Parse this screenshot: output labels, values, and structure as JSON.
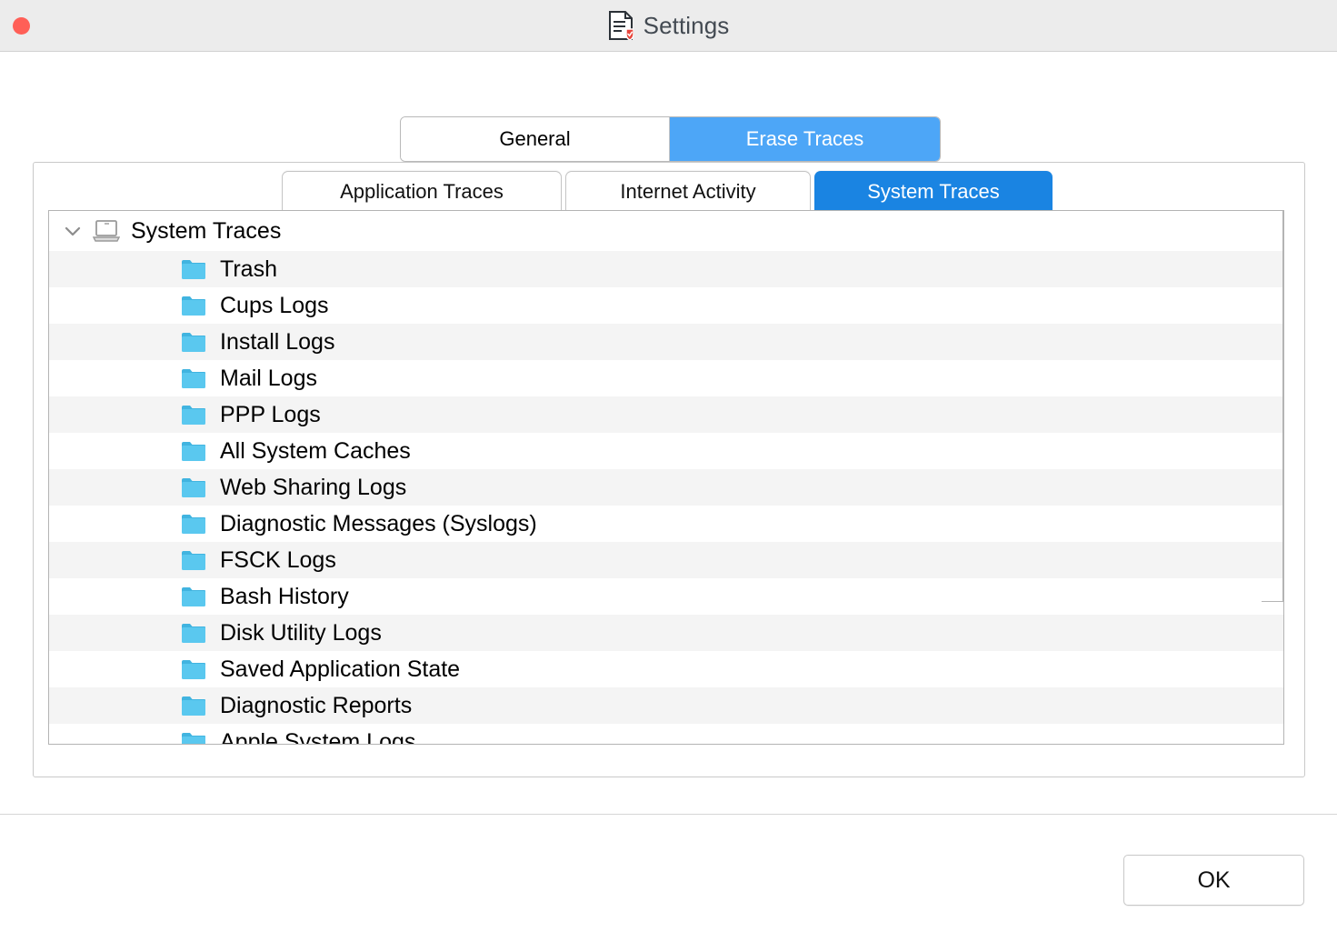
{
  "window": {
    "title": "Settings",
    "title_icon": "document-shield-icon",
    "close_button": "close-window-button",
    "close_color": "#ff5f57",
    "titlebar_color": "#ececec"
  },
  "outer_tabs": {
    "active": "Erase Traces",
    "active_color": "#4da6f7",
    "items": [
      {
        "label": "General",
        "active": false
      },
      {
        "label": "Erase Traces",
        "active": true
      }
    ]
  },
  "inner_tabs": {
    "active": "System Traces",
    "active_color": "#1a84e2",
    "items": [
      {
        "label": "Application Traces",
        "active": false
      },
      {
        "label": "Internet Activity",
        "active": false
      },
      {
        "label": "System Traces",
        "active": true
      }
    ]
  },
  "tree": {
    "root": {
      "label": "System Traces",
      "icon": "laptop-icon",
      "expander": "chevron-down-icon",
      "expanded": true
    },
    "folder_icon": "folder-icon",
    "folder_color": "#5ac8ef",
    "items": [
      {
        "label": "Trash"
      },
      {
        "label": "Cups Logs"
      },
      {
        "label": "Install Logs"
      },
      {
        "label": "Mail Logs"
      },
      {
        "label": "PPP Logs"
      },
      {
        "label": "All System Caches"
      },
      {
        "label": "Web Sharing Logs"
      },
      {
        "label": "Diagnostic Messages (Syslogs)"
      },
      {
        "label": "FSCK Logs"
      },
      {
        "label": "Bash History"
      },
      {
        "label": "Disk Utility Logs"
      },
      {
        "label": "Saved Application State"
      },
      {
        "label": "Diagnostic Reports"
      },
      {
        "label": "Apple System Logs"
      }
    ]
  },
  "footer": {
    "ok_label": "OK"
  }
}
